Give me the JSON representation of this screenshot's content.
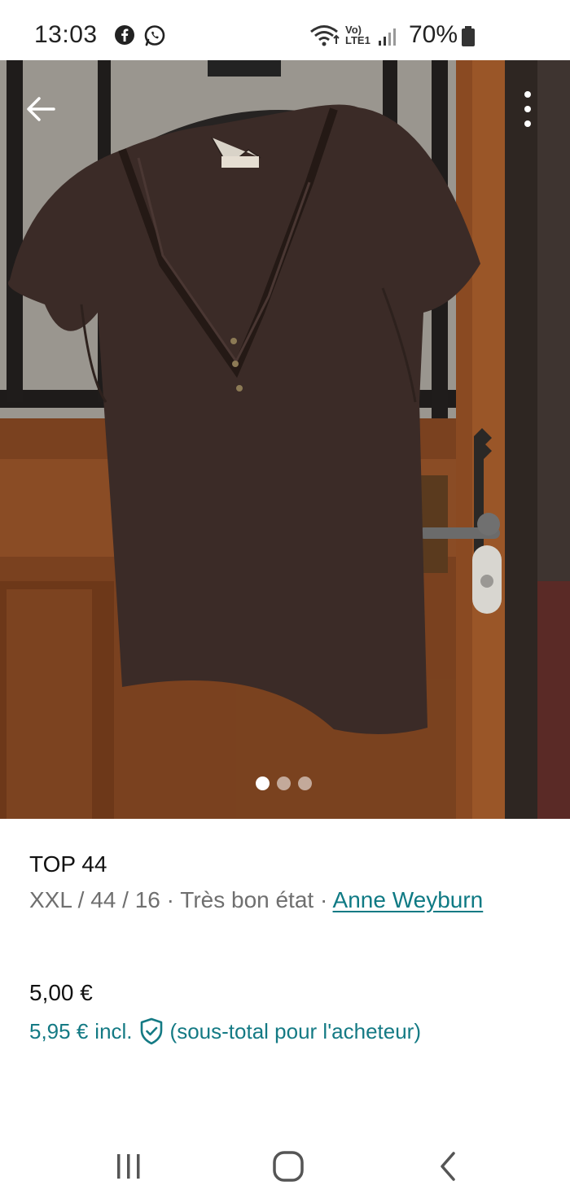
{
  "status_bar": {
    "time": "13:03",
    "network_label": "Vo)\nLTE1",
    "battery": "70%",
    "icons": [
      "facebook-icon",
      "whatsapp-icon",
      "wifi-icon",
      "signal-icon",
      "battery-icon"
    ]
  },
  "gallery": {
    "current_index": 1,
    "total": 3
  },
  "item": {
    "title": "TOP 44",
    "size": "XXL / 44 / 16",
    "separator": " · ",
    "condition": "Très bon état",
    "brand": "Anne Weyburn",
    "price": "5,00 €",
    "price_incl": "5,95 €",
    "incl_label": "incl.",
    "incl_note": "(sous-total pour l'acheteur)"
  },
  "colors": {
    "accent": "#147a84",
    "meta_text": "#6f6f6f",
    "wood": "#6e3a1c",
    "shirt": "#3a2a26"
  }
}
